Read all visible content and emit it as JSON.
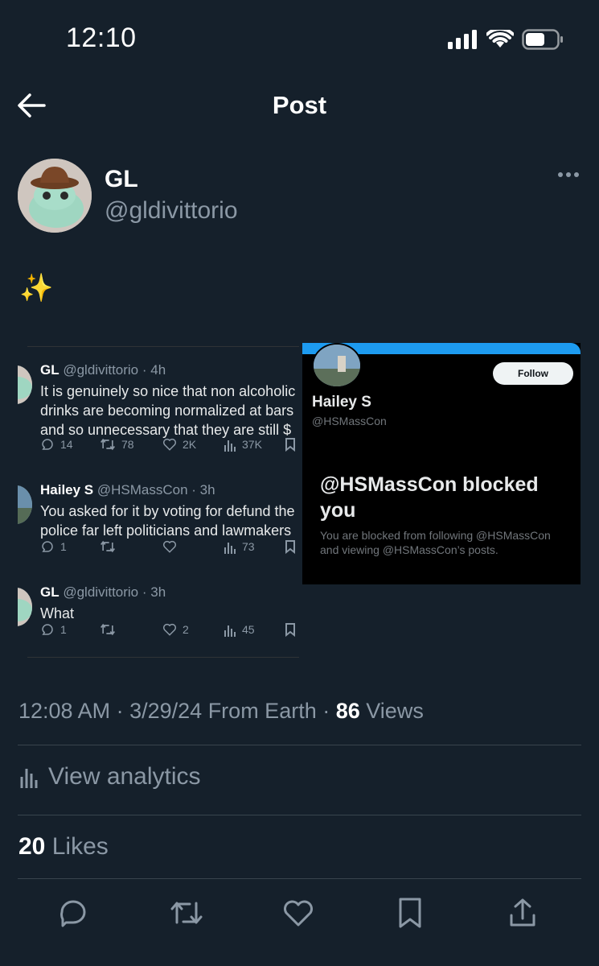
{
  "status_bar": {
    "time": "12:10"
  },
  "nav": {
    "title": "Post"
  },
  "author": {
    "name": "GL",
    "handle": "@gldivittorio"
  },
  "post_text": "✨",
  "left_screenshot": {
    "tweets": [
      {
        "name": "GL",
        "meta": "@gldivittorio · 4h",
        "lines": [
          "It is genuinely so nice that non alcoholic",
          "drinks are becoming normalized at bars",
          "and so unnecessary that they are still $"
        ],
        "replies": "14",
        "retweets": "78",
        "likes": "2K",
        "views": "37K"
      },
      {
        "name": "Hailey S",
        "meta": "@HSMassCon · 3h",
        "lines": [
          "You asked for it by voting for defund the",
          "police far left politicians and lawmakers"
        ],
        "replies": "1",
        "retweets": "",
        "likes": "",
        "views": "73"
      },
      {
        "name": "GL",
        "meta": "@gldivittorio · 3h",
        "lines": [
          "What"
        ],
        "replies": "1",
        "retweets": "",
        "likes": "2",
        "views": "45"
      }
    ]
  },
  "right_screenshot": {
    "follow_label": "Follow",
    "name": "Hailey S",
    "handle": "@HSMassCon",
    "blocked_title": "@HSMassCon blocked you",
    "blocked_text": "You are blocked from following @HSMassCon and viewing @HSMassCon’s posts."
  },
  "meta": {
    "time": "12:08 AM",
    "date": "3/29/24",
    "source": "From Earth",
    "views_count": "86",
    "views_label": "Views"
  },
  "analytics": {
    "label": "View analytics"
  },
  "likes": {
    "count": "20",
    "label": "Likes"
  },
  "colors": {
    "background": "#15202b",
    "accent": "#1d9bf0",
    "muted": "#8b98a5"
  }
}
